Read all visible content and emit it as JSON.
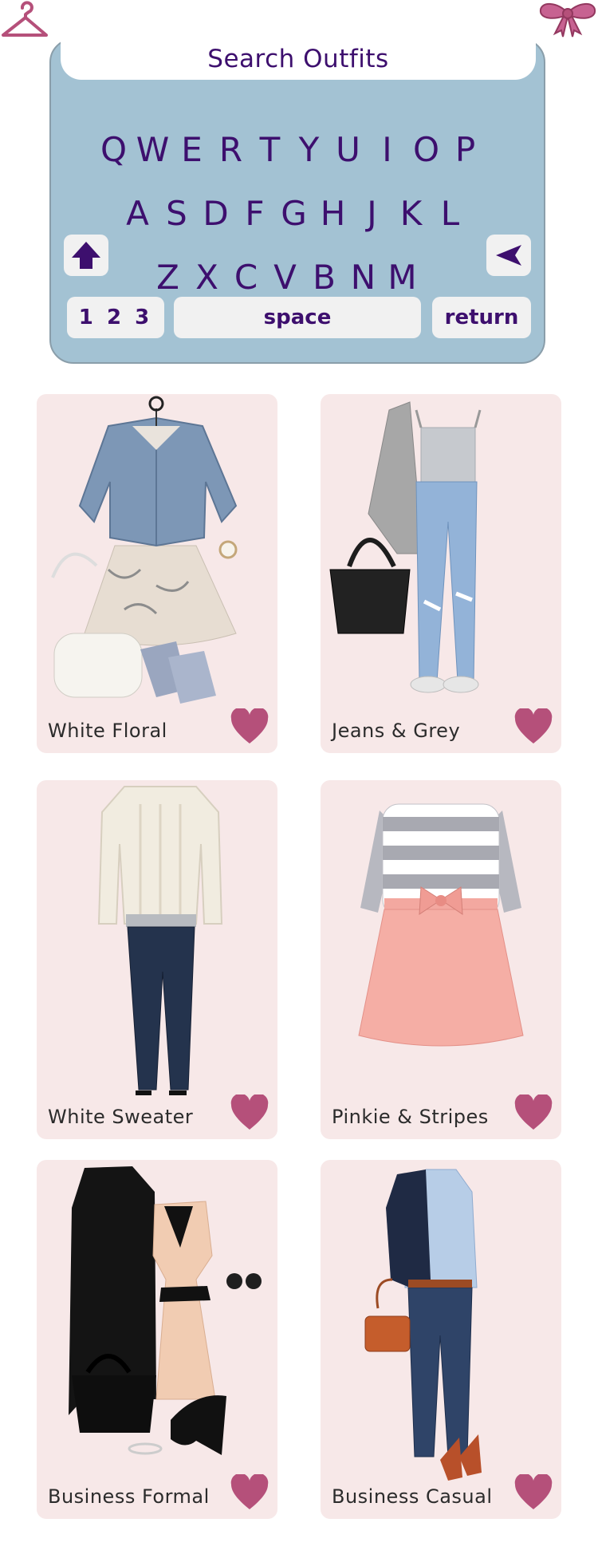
{
  "search": {
    "title": "Search Outfits"
  },
  "keyboard": {
    "row1": [
      "Q",
      "W",
      "E",
      "R",
      "T",
      "Y",
      "U",
      "I",
      "O",
      "P"
    ],
    "row2": [
      "A",
      "S",
      "D",
      "F",
      "G",
      "H",
      "J",
      "K",
      "L"
    ],
    "row3": [
      "Z",
      "X",
      "C",
      "V",
      "B",
      "N",
      "M"
    ],
    "numbers_label": "1 2 3",
    "space_label": "space",
    "return_label": "return",
    "shift_icon": "shift-arrow-icon",
    "backspace_icon": "backspace-triangle-icon"
  },
  "outfits": [
    {
      "label": "White Floral",
      "icon": "heart-icon"
    },
    {
      "label": "Jeans & Grey",
      "icon": "heart-icon"
    },
    {
      "label": "White Sweater",
      "icon": "heart-icon"
    },
    {
      "label": "Pinkie & Stripes",
      "icon": "heart-icon"
    },
    {
      "label": "Business Formal",
      "icon": "heart-icon"
    },
    {
      "label": "Business Casual",
      "icon": "heart-icon"
    }
  ],
  "decor": {
    "left_icon": "hanger-icon",
    "right_icon": "bow-icon"
  },
  "colors": {
    "accent": "#b5507a",
    "keyboard_bg": "#a3c2d3",
    "key_text": "#3d0f6e",
    "card_bg": "#f7e8e8"
  }
}
